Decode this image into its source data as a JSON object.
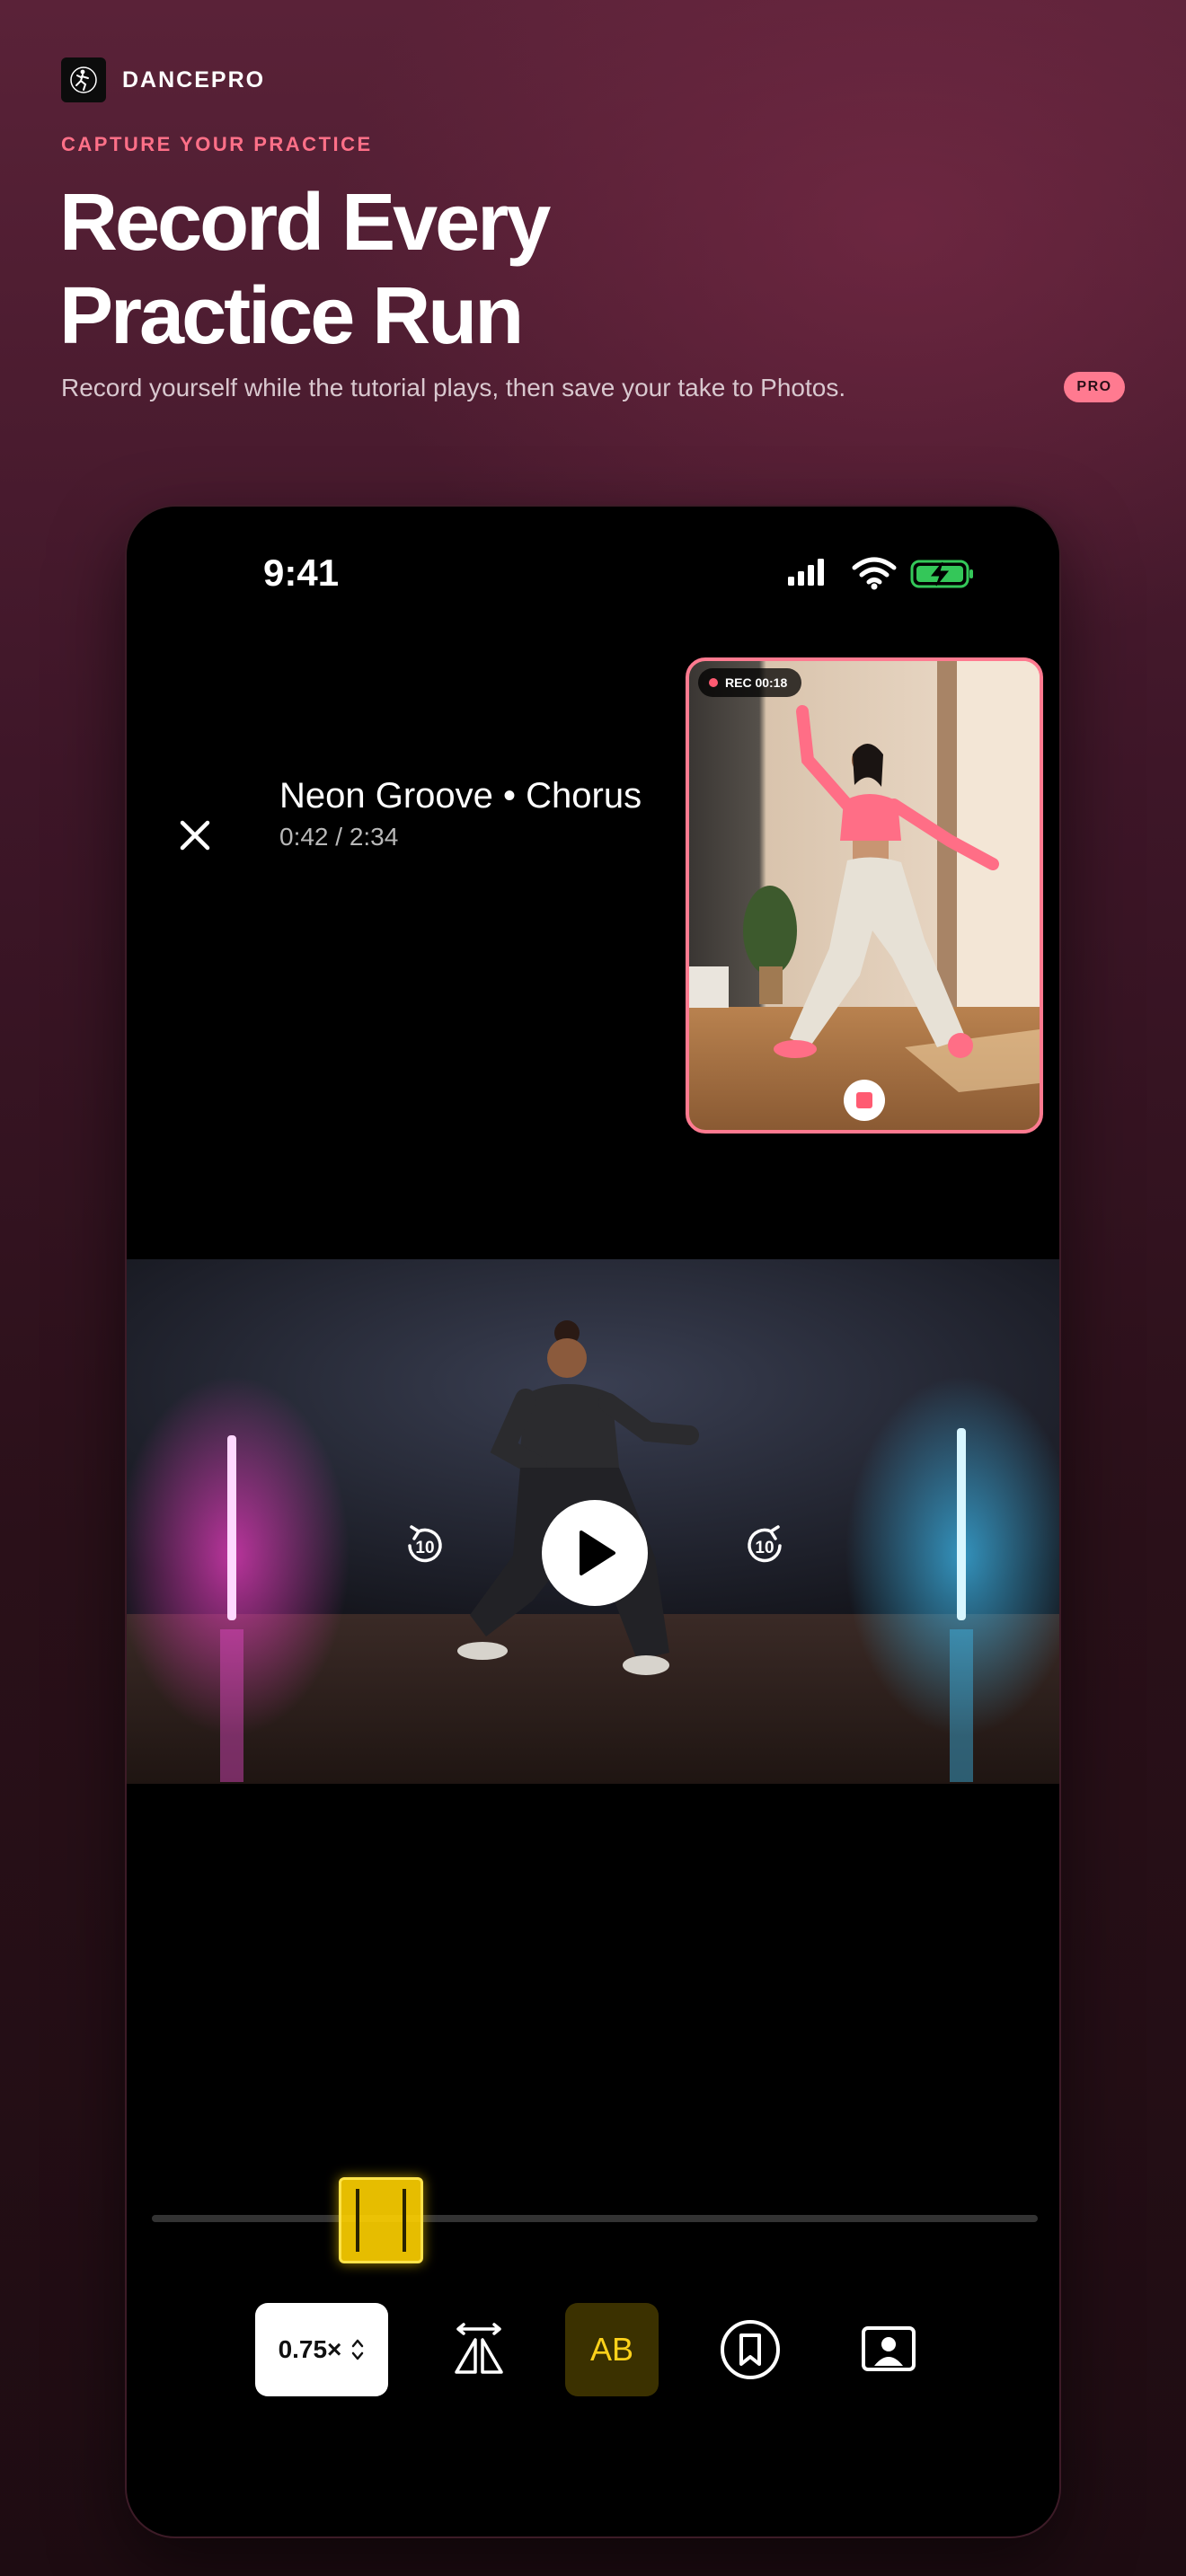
{
  "brand": {
    "name": "DANCEPRO",
    "logo_icon": "dancer-logo-icon"
  },
  "hero": {
    "eyebrow": "CAPTURE YOUR PRACTICE",
    "headline_line1": "Record Every",
    "headline_line2": "Practice Run",
    "subtitle": "Record yourself while the tutorial plays, then save your take to Photos.",
    "badge": "PRO"
  },
  "status_bar": {
    "time": "9:41",
    "icons": [
      "signal-icon",
      "wifi-icon",
      "battery-charging-icon"
    ]
  },
  "player": {
    "title": "Neon Groove • Chorus",
    "time": "0:42 / 2:34",
    "skip_back_label": "10",
    "skip_forward_label": "10"
  },
  "recording": {
    "label": "REC 00:18"
  },
  "controls": {
    "speed": "0.75×",
    "ab_label": "AB"
  },
  "colors": {
    "accent": "#ff7a90",
    "loop_yellow": "#ffd21a",
    "battery_green": "#34c759"
  }
}
